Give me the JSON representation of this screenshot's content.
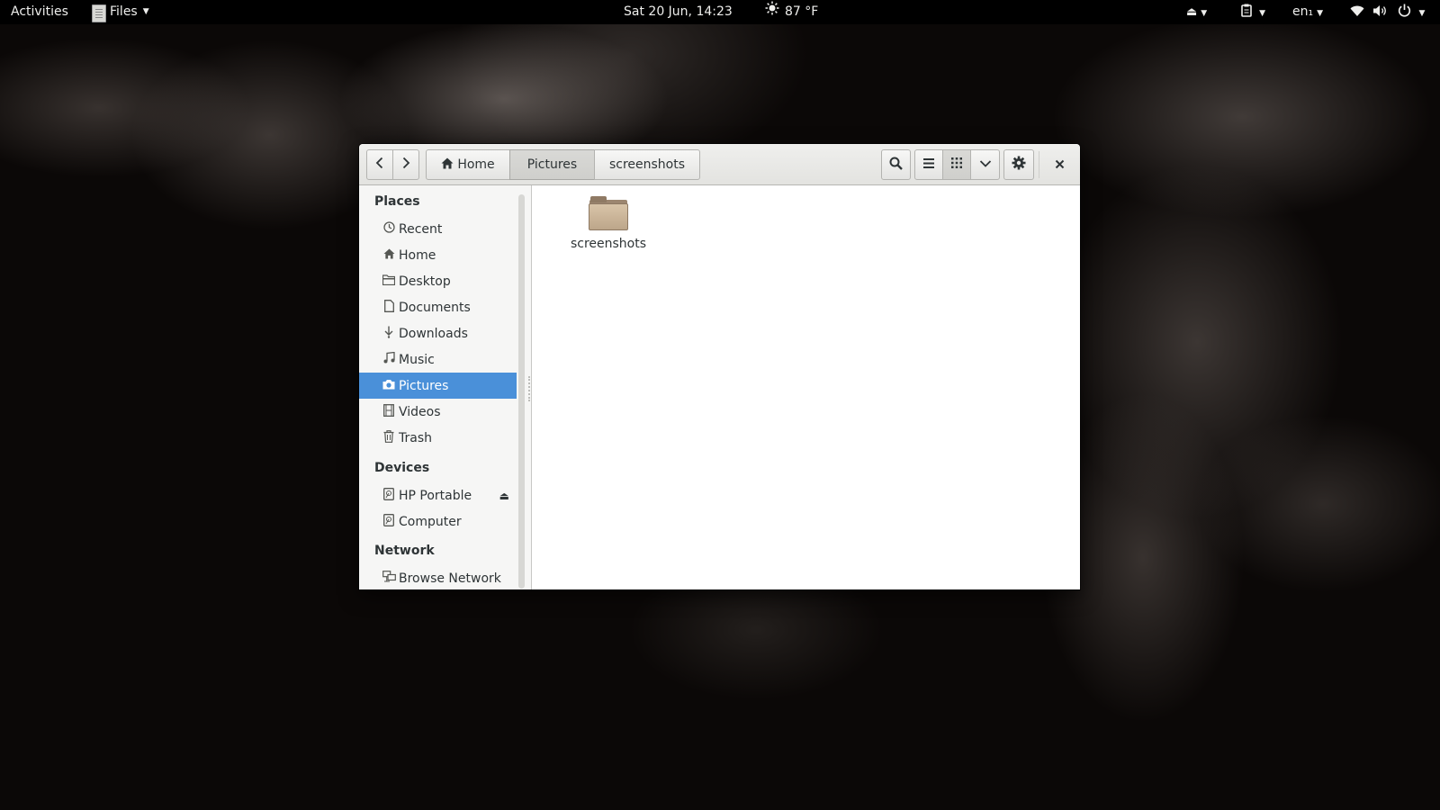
{
  "topbar": {
    "activities": "Activities",
    "app_name": "Files",
    "clock": "Sat 20 Jun, 14:23",
    "weather": "87 °F",
    "language": "en₁",
    "icons": [
      "eject-icon",
      "clipboard-icon",
      "wifi-icon",
      "volume-icon",
      "power-icon"
    ]
  },
  "window": {
    "breadcrumbs": [
      {
        "label": "Home",
        "icon": "home-icon"
      },
      {
        "label": "Pictures",
        "active": true
      },
      {
        "label": "screenshots"
      }
    ],
    "view_mode": "grid"
  },
  "sidebar": {
    "sections": [
      {
        "heading": "Places"
      },
      {
        "heading": "Devices"
      },
      {
        "heading": "Network"
      }
    ],
    "places": [
      {
        "label": "Recent",
        "icon": "clock-icon"
      },
      {
        "label": "Home",
        "icon": "home-icon"
      },
      {
        "label": "Desktop",
        "icon": "folder-icon"
      },
      {
        "label": "Documents",
        "icon": "document-icon"
      },
      {
        "label": "Downloads",
        "icon": "download-icon"
      },
      {
        "label": "Music",
        "icon": "music-icon"
      },
      {
        "label": "Pictures",
        "icon": "camera-icon",
        "active": true
      },
      {
        "label": "Videos",
        "icon": "film-icon"
      },
      {
        "label": "Trash",
        "icon": "trash-icon"
      }
    ],
    "devices": [
      {
        "label": "HP Portable",
        "icon": "drive-icon",
        "eject": true
      },
      {
        "label": "Computer",
        "icon": "drive-icon"
      }
    ],
    "network": [
      {
        "label": "Browse Network",
        "icon": "network-icon"
      }
    ]
  },
  "content": {
    "items": [
      {
        "name": "screenshots",
        "type": "folder"
      }
    ]
  },
  "colors": {
    "selection": "#4a90d9",
    "topbar": "#000000",
    "folder": "#c9b396"
  }
}
